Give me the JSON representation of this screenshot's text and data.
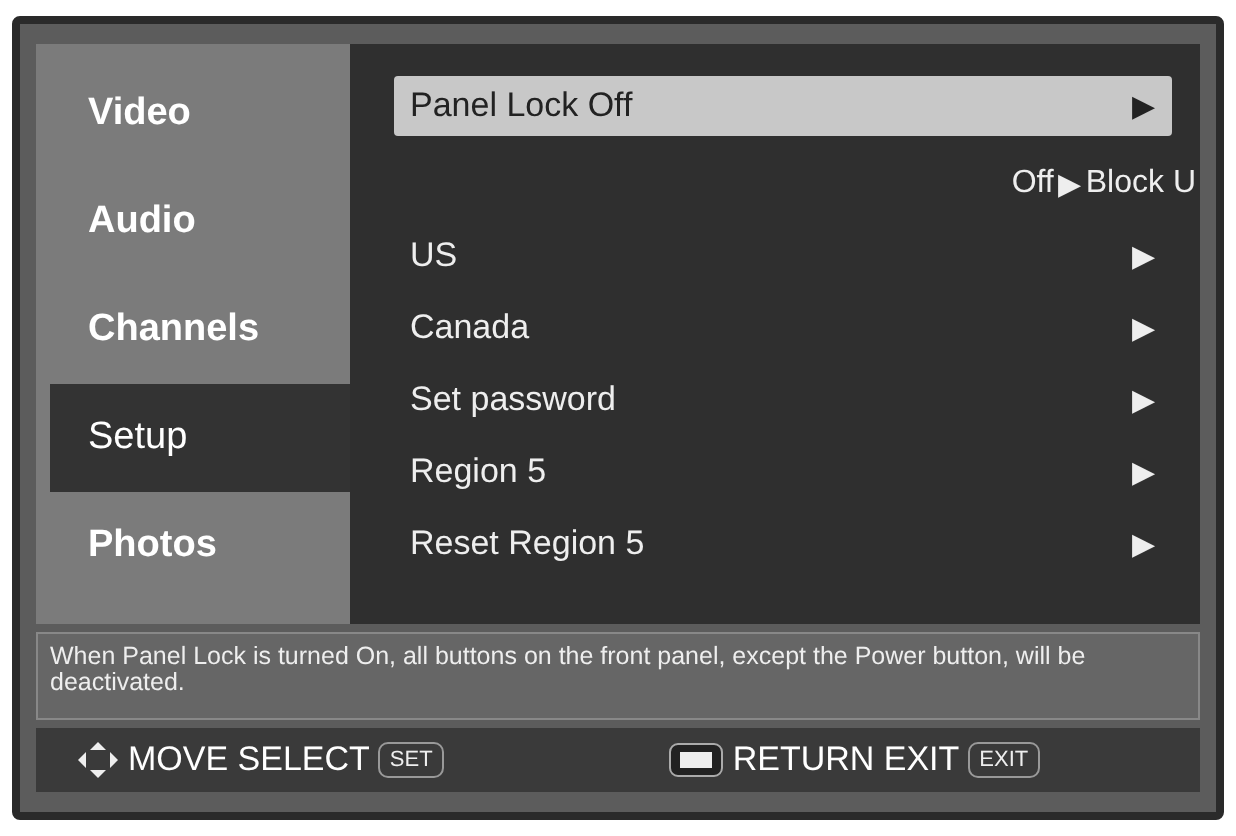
{
  "sidebar": {
    "items": [
      {
        "label": "Video",
        "selected": false
      },
      {
        "label": "Audio",
        "selected": false
      },
      {
        "label": "Channels",
        "selected": false
      },
      {
        "label": "Setup",
        "selected": true
      },
      {
        "label": "Photos",
        "selected": false
      }
    ]
  },
  "menu": {
    "rows": [
      {
        "kind": "option",
        "label": "Panel Lock Off",
        "arrow": "▶",
        "selected": true
      },
      {
        "kind": "overlay",
        "label": "Off",
        "arrow": "▶",
        "extra": "Block U"
      },
      {
        "kind": "option",
        "label": "US",
        "arrow": "▶",
        "selected": false
      },
      {
        "kind": "option",
        "label": "Canada",
        "arrow": "▶",
        "selected": false
      },
      {
        "kind": "option",
        "label": "Set password",
        "arrow": "▶",
        "selected": false
      },
      {
        "kind": "option",
        "label": "Region 5",
        "arrow": "▶",
        "selected": false
      },
      {
        "kind": "option",
        "label": "Reset Region 5",
        "arrow": "▶",
        "selected": false
      }
    ]
  },
  "help": "When Panel Lock is turned On, all buttons on the front panel, except the Power button, will be deactivated.",
  "footer": [
    {
      "kind": "move",
      "label": "MOVE SELECT",
      "key": "SET"
    },
    {
      "kind": "return",
      "label": "RETURN EXIT",
      "key": "EXIT"
    }
  ]
}
